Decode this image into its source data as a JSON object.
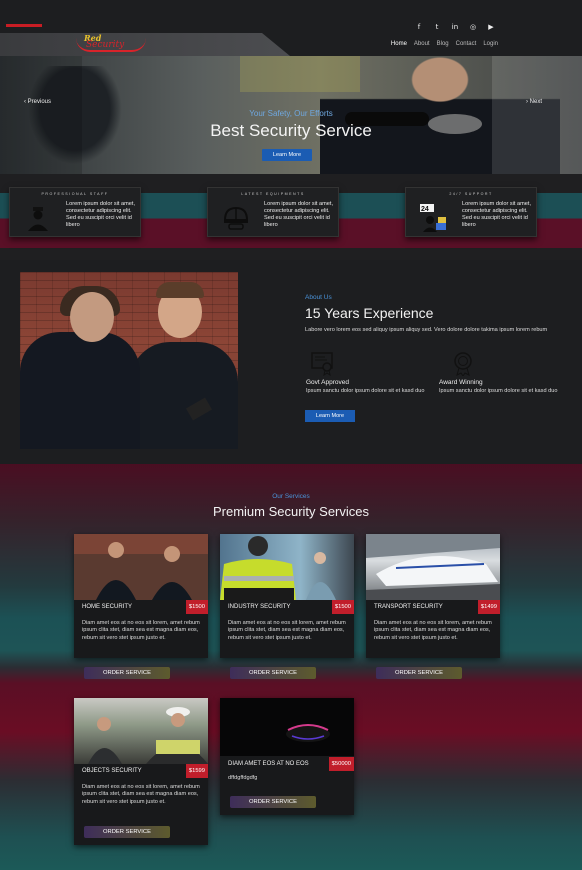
{
  "brand": {
    "line1": "Red",
    "line2": "Security",
    "accent": "#c81d24"
  },
  "social_icons": [
    "facebook-icon",
    "twitter-icon",
    "linkedin-icon",
    "instagram-icon",
    "youtube-icon"
  ],
  "nav": [
    {
      "label": "Home",
      "active": true
    },
    {
      "label": "About"
    },
    {
      "label": "Blog"
    },
    {
      "label": "Contact"
    },
    {
      "label": "Login"
    }
  ],
  "hero": {
    "subtitle": "Your Safety, Our Efforts",
    "title": "Best Security Service",
    "button": "Learn More",
    "prev": "Previous",
    "next": "Next"
  },
  "features": [
    {
      "title": "PROFESSIONAL STAFF",
      "text": "Lorem ipsum dolor sit amet, consectetur adipiscing elit. Sed eu suscipit orci velit id libero",
      "icon": "guard-icon"
    },
    {
      "title": "LATEST EQUIPMENTS",
      "text": "Lorem ipsum dolor sit amet, consectetur adipiscing elit. Sed eu suscipit orci velit id libero",
      "icon": "helmet-icon"
    },
    {
      "title": "24/7 SUPPORT",
      "text": "Lorem ipsum dolor sit amet, consectetur adipiscing elit. Sed eu suscipit orci velit id libero",
      "icon": "support-24-7-icon"
    }
  ],
  "about": {
    "tag": "About Us",
    "title": "15 Years Experience",
    "desc": "Labore vero lorem eos sed aliquy ipsum aliquy sed. Vero dolore dolore takima ipsum lorem rebum",
    "items": [
      {
        "title": "Govt Approved",
        "text": "Ipsum sanctu dolor ipsum dolore sit et kasd duo",
        "icon": "certificate-icon"
      },
      {
        "title": "Award Winning",
        "text": "Ipsum sanctu dolor ipsum dolore sit et kasd duo",
        "icon": "award-icon"
      }
    ],
    "button": "Learn More"
  },
  "services": {
    "tag": "Our Services",
    "title": "Premium Security Services",
    "order_label": "ORDER SERVICE",
    "cards": [
      {
        "title": "HOME SECURITY",
        "price": "$1500",
        "text": "Diam amet eos at no eos sit lorem, amet rebum ipsum clita stet, diam sea est magna diam eos, rebum sit vero stet ipsum justo et."
      },
      {
        "title": "INDUSTRY SECURITY",
        "price": "$1500",
        "text": "Diam amet eos at no eos sit lorem, amet rebum ipsum clita stet, diam sea est magna diam eos, rebum sit vero stet ipsum justo et."
      },
      {
        "title": "TRANSPORT SECURITY",
        "price": "$1499",
        "text": "Diam amet eos at no eos sit lorem, amet rebum ipsum clita stet, diam sea est magna diam eos, rebum sit vero stet ipsum justo et."
      },
      {
        "title": "OBJECTS SECURITY",
        "price": "$1599",
        "text": "Diam amet eos at no eos sit lorem, amet rebum ipsum clita stet, diam sea est magna diam eos, rebum sit vero stet ipsum justo et."
      },
      {
        "title": "DIAM AMET EOS AT NO EOS",
        "price": "$50000",
        "text": "dffdgffdgdfg"
      }
    ]
  }
}
